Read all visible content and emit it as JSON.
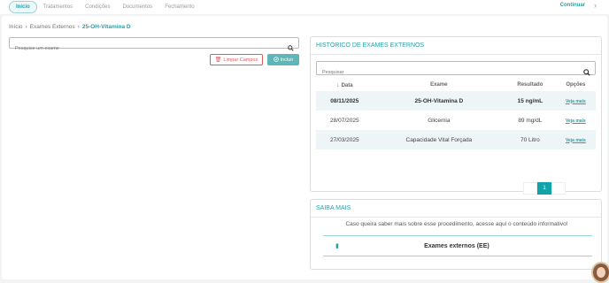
{
  "nav": {
    "tabs": [
      {
        "label": "Início",
        "active": true
      },
      {
        "label": "Tratamentos",
        "active": false
      },
      {
        "label": "Condições",
        "active": false
      },
      {
        "label": "Documentos",
        "active": false
      },
      {
        "label": "Fechamento",
        "active": false
      }
    ],
    "continue_label": "Continuar"
  },
  "breadcrumb": {
    "items": [
      "Início",
      "›",
      "Exames Externos",
      "›"
    ],
    "current": "25-OH-Vitamina D"
  },
  "search_left": {
    "placeholder": "Pesquise um exame",
    "icon": "search-icon"
  },
  "buttons": {
    "clear_label": "Limpar Campos",
    "clear_icon": "trash-icon",
    "include_label": "Incluir",
    "include_icon": "check-circle-icon"
  },
  "history": {
    "title": "HISTÓRICO DE EXAMES EXTERNOS",
    "search_placeholder": "Pesquisar",
    "columns": [
      "Data",
      "Exame",
      "Resultado",
      "Opções"
    ],
    "rows": [
      {
        "date": "08/11/2025",
        "exam": "25-OH-Vitamina D",
        "result": "15 ng/mL",
        "option": "Veja mais"
      },
      {
        "date": "28/07/2025",
        "exam": "Glicemia",
        "result": "89 mg/dL",
        "option": "Veja mais"
      },
      {
        "date": "27/03/2025",
        "exam": "Capacidade Vital Forçada",
        "result": "70 Litro",
        "option": "Veja mais"
      }
    ],
    "current_page": "1"
  },
  "saiba": {
    "title": "SAIBA MAIS",
    "text": "Caso queira saber mais sobre esse procedimento, acesse aqui o conteúdo informativo!",
    "item_label": "Exames externos (EE)",
    "item_icon": "book-icon"
  },
  "colors": {
    "accent": "#2a9fa4",
    "danger": "#e25a5a",
    "primary_button": "#5fb6b8"
  }
}
